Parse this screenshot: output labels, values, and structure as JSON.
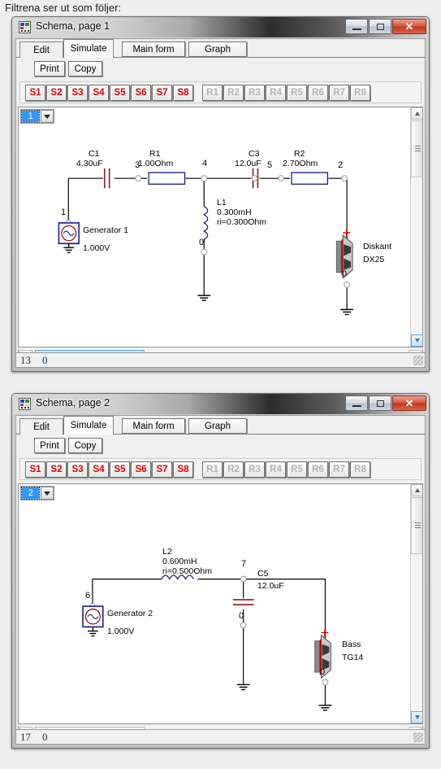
{
  "caption": "Filtrena ser ut som följer:",
  "colors": {
    "accent_red": "#e00000",
    "wire": "#000000",
    "component_blue": "#1a1a8c",
    "capacitor_red": "#8b1a1a",
    "selection_blue": "#3399ff",
    "close_button": "#c0392b"
  },
  "windows": [
    {
      "title": "Schema, page 1",
      "icon": "schematic-icon",
      "window_buttons": {
        "minimize": "minimize-icon",
        "maximize": "maximize-icon",
        "close": "close-icon",
        "close_glyph": "✕"
      },
      "tabs": [
        {
          "label": "Edit",
          "selected": false
        },
        {
          "label": "Simulate",
          "selected": true
        }
      ],
      "toolbar": {
        "main_form": "Main form",
        "graph": "Graph",
        "print": "Print",
        "copy": "Copy"
      },
      "s_buttons": [
        "S1",
        "S2",
        "S3",
        "S4",
        "S5",
        "S6",
        "S7",
        "S8"
      ],
      "r_buttons": [
        "R1",
        "R2",
        "R3",
        "R4",
        "R5",
        "R6",
        "R7",
        "R8"
      ],
      "page_selector": {
        "value": "1",
        "arrow": "chevron-down-icon"
      },
      "scrollbar_thumb_style": "blue",
      "status": {
        "left": "13",
        "right": "0"
      },
      "schematic": {
        "generator": {
          "node": "1",
          "name": "Generator 1",
          "value": "1.000V"
        },
        "components": [
          {
            "ref": "C1",
            "value": "4.30uF",
            "type": "capacitor"
          },
          {
            "ref": "R1",
            "value": "1.00Ohm",
            "type": "resistor"
          },
          {
            "ref": "L1",
            "value": "0.300mH",
            "value2": "ri=0.300Ohm",
            "type": "inductor"
          },
          {
            "ref": "C3",
            "value": "12.0uF",
            "type": "capacitor"
          },
          {
            "ref": "R2",
            "value": "2.70Ohm",
            "type": "resistor"
          }
        ],
        "nodes": [
          "1",
          "3",
          "4",
          "5",
          "2",
          "0"
        ],
        "speaker": {
          "name": "Diskant",
          "model": "DX25",
          "plus": "+",
          "minus_node": "0"
        }
      }
    },
    {
      "title": "Schema, page 2",
      "icon": "schematic-icon",
      "window_buttons": {
        "minimize": "minimize-icon",
        "maximize": "maximize-icon",
        "close": "close-icon",
        "close_glyph": "✕"
      },
      "tabs": [
        {
          "label": "Edit",
          "selected": false
        },
        {
          "label": "Simulate",
          "selected": true
        }
      ],
      "toolbar": {
        "main_form": "Main form",
        "graph": "Graph",
        "print": "Print",
        "copy": "Copy"
      },
      "s_buttons": [
        "S1",
        "S2",
        "S3",
        "S4",
        "S5",
        "S6",
        "S7",
        "S8"
      ],
      "r_buttons": [
        "R1",
        "R2",
        "R3",
        "R4",
        "R5",
        "R6",
        "R7",
        "R8"
      ],
      "page_selector": {
        "value": "2",
        "arrow": "chevron-down-icon"
      },
      "scrollbar_thumb_style": "gray",
      "status": {
        "left": "17",
        "right": "0"
      },
      "schematic": {
        "generator": {
          "node": "6",
          "name": "Generator 2",
          "value": "1.000V"
        },
        "components": [
          {
            "ref": "L2",
            "value": "0.600mH",
            "value2": "ri=0.500Ohm",
            "type": "inductor"
          },
          {
            "ref": "C5",
            "value": "12.0uF",
            "type": "capacitor"
          }
        ],
        "nodes": [
          "6",
          "7",
          "0"
        ],
        "speaker": {
          "name": "Bass",
          "model": "TG14",
          "plus": "+",
          "minus_node": "0"
        }
      }
    }
  ]
}
